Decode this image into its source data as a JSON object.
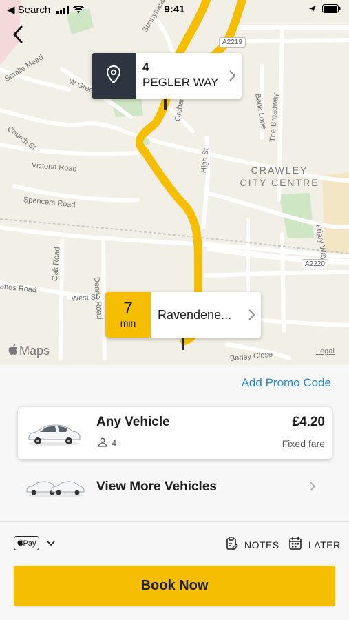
{
  "status_bar": {
    "back_app": "◀ Search",
    "time": "9:41"
  },
  "map": {
    "streets": [
      "Smalls Mead",
      "W Green",
      "Sunnymead",
      "Church St",
      "Victoria Road",
      "Spencers Road",
      "High St",
      "Bank Lane",
      "The Broadway",
      "Orchard",
      "Oak Road",
      "Denne Road",
      "West St",
      "ands Road",
      "Friary Way",
      "Barley Close"
    ],
    "area_label": "CRAWLEY\nCITY CENTRE",
    "road_shields": [
      "A2219",
      "A2220"
    ],
    "attribution": "Maps",
    "legal": "Legal",
    "route_color": "#f6be00"
  },
  "pickup": {
    "number": "4",
    "street": "PEGLER WAY",
    "icon": "location-pin-icon"
  },
  "dropoff": {
    "minutes": "7",
    "unit": "min",
    "name": "Ravendene..."
  },
  "sheet": {
    "promo_label": "Add Promo Code",
    "vehicle": {
      "name": "Any Vehicle",
      "seats": "4",
      "price": "£4.20",
      "fare_type": "Fixed fare"
    },
    "more_vehicles_label": "View More Vehicles",
    "payment_badge": "Pay",
    "notes_label": "NOTES",
    "later_label": "LATER",
    "book_label": "Book Now"
  },
  "colors": {
    "accent": "#f6be00",
    "link": "#1f87d6",
    "pickup_badge": "#2f3441"
  }
}
